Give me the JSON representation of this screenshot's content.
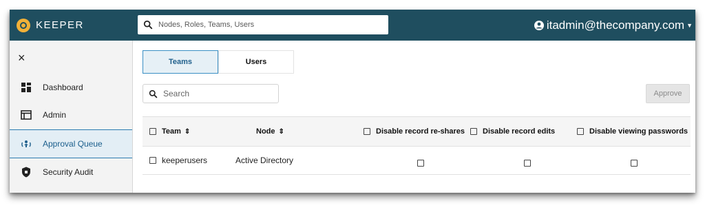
{
  "header": {
    "brand": "KEEPER",
    "search_placeholder": "Nodes, Roles, Teams, Users",
    "user_email": "itadmin@thecompany.com"
  },
  "sidebar": {
    "close_label": "×",
    "items": [
      {
        "label": "Dashboard",
        "icon": "dashboard-icon"
      },
      {
        "label": "Admin",
        "icon": "admin-window-icon"
      },
      {
        "label": "Approval Queue",
        "icon": "approval-queue-icon",
        "active": true
      },
      {
        "label": "Security Audit",
        "icon": "shield-icon"
      }
    ]
  },
  "main": {
    "tabs": [
      {
        "label": "Teams",
        "active": true
      },
      {
        "label": "Users",
        "active": false
      }
    ],
    "search_placeholder": "Search",
    "approve_label": "Approve",
    "table": {
      "columns": [
        "Team",
        "Node",
        "Disable record re-shares",
        "Disable record edits",
        "Disable viewing passwords"
      ],
      "sort_glyph": "⇕",
      "rows": [
        {
          "team": "keeperusers",
          "node": "Active Directory",
          "reshares": false,
          "edits": false,
          "viewing": false
        }
      ]
    }
  },
  "colors": {
    "topbar": "#1f4e5f",
    "logo": "#f2b138",
    "accent": "#3a8fc4"
  }
}
